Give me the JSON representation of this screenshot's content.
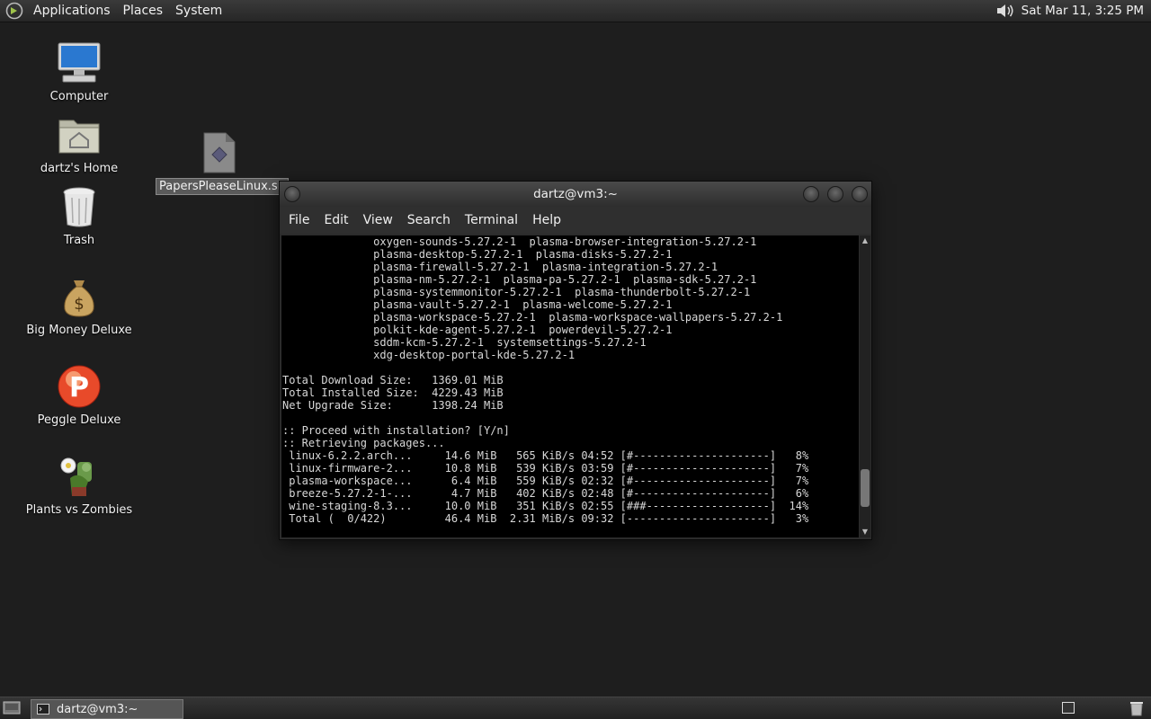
{
  "top_panel": {
    "menus": [
      "Applications",
      "Places",
      "System"
    ],
    "clock": "Sat Mar 11,  3:25 PM",
    "icons": [
      "distro-logo",
      "volume-icon"
    ]
  },
  "desktop": {
    "icons": [
      {
        "label": "Computer",
        "icon": "computer-icon"
      },
      {
        "label": "dartz's Home",
        "icon": "home-folder-icon"
      },
      {
        "label": "Trash",
        "icon": "trash-icon"
      },
      {
        "label": "Big Money Deluxe",
        "icon": "money-bag-icon"
      },
      {
        "label": "Peggle Deluxe",
        "icon": "peggle-icon"
      },
      {
        "label": "Plants vs Zombies",
        "icon": "plants-vs-zombies-icon"
      },
      {
        "label": "PapersPleaseLinux.sh",
        "icon": "script-file-icon",
        "selected": true
      }
    ]
  },
  "terminal": {
    "title": "dartz@vm3:~",
    "menu": [
      "File",
      "Edit",
      "View",
      "Search",
      "Terminal",
      "Help"
    ],
    "lines": [
      "              oxygen-sounds-5.27.2-1  plasma-browser-integration-5.27.2-1",
      "              plasma-desktop-5.27.2-1  plasma-disks-5.27.2-1",
      "              plasma-firewall-5.27.2-1  plasma-integration-5.27.2-1",
      "              plasma-nm-5.27.2-1  plasma-pa-5.27.2-1  plasma-sdk-5.27.2-1",
      "              plasma-systemmonitor-5.27.2-1  plasma-thunderbolt-5.27.2-1",
      "              plasma-vault-5.27.2-1  plasma-welcome-5.27.2-1",
      "              plasma-workspace-5.27.2-1  plasma-workspace-wallpapers-5.27.2-1",
      "              polkit-kde-agent-5.27.2-1  powerdevil-5.27.2-1",
      "              sddm-kcm-5.27.2-1  systemsettings-5.27.2-1",
      "              xdg-desktop-portal-kde-5.27.2-1",
      "",
      "Total Download Size:   1369.01 MiB",
      "Total Installed Size:  4229.43 MiB",
      "Net Upgrade Size:      1398.24 MiB",
      "",
      ":: Proceed with installation? [Y/n]",
      ":: Retrieving packages...",
      " linux-6.2.2.arch...     14.6 MiB   565 KiB/s 04:52 [#---------------------]   8%",
      " linux-firmware-2...     10.8 MiB   539 KiB/s 03:59 [#---------------------]   7%",
      " plasma-workspace...      6.4 MiB   559 KiB/s 02:32 [#---------------------]   7%",
      " breeze-5.27.2-1-...      4.7 MiB   402 KiB/s 02:48 [#---------------------]   6%",
      " wine-staging-8.3...     10.0 MiB   351 KiB/s 02:55 [###-------------------]  14%",
      " Total (  0/422)         46.4 MiB  2.31 MiB/s 09:32 [----------------------]   3%"
    ],
    "scrollbar_position": 0.92
  },
  "bottom_panel": {
    "task": {
      "label": "dartz@vm3:~",
      "icon": "terminal-icon"
    },
    "icons": [
      "show-desktop-icon",
      "workspace-switcher",
      "trash-applet-icon"
    ]
  }
}
